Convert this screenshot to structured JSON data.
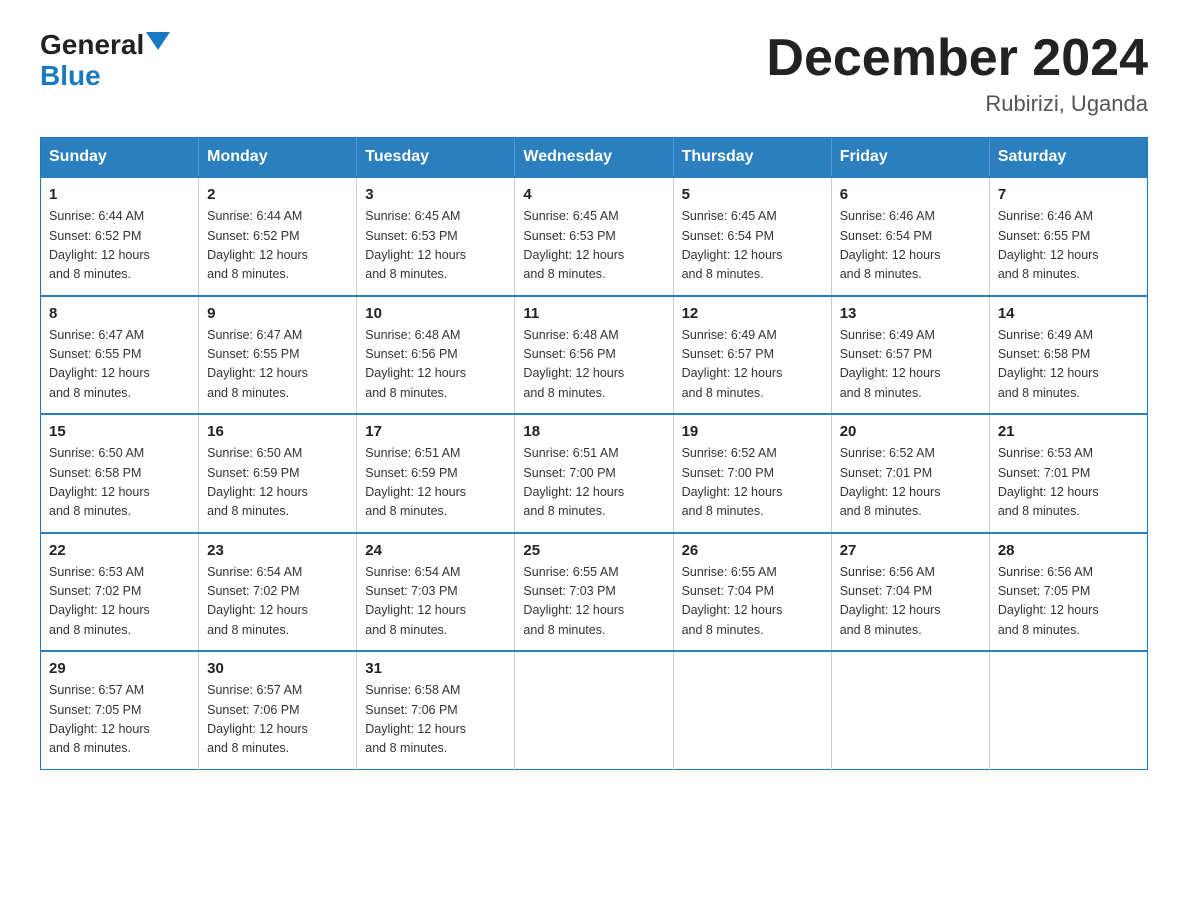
{
  "header": {
    "logo_general": "General",
    "logo_blue": "Blue",
    "month_title": "December 2024",
    "location": "Rubirizi, Uganda"
  },
  "days_of_week": [
    "Sunday",
    "Monday",
    "Tuesday",
    "Wednesday",
    "Thursday",
    "Friday",
    "Saturday"
  ],
  "weeks": [
    [
      {
        "day": "1",
        "sunrise": "6:44 AM",
        "sunset": "6:52 PM",
        "daylight": "12 hours and 8 minutes."
      },
      {
        "day": "2",
        "sunrise": "6:44 AM",
        "sunset": "6:52 PM",
        "daylight": "12 hours and 8 minutes."
      },
      {
        "day": "3",
        "sunrise": "6:45 AM",
        "sunset": "6:53 PM",
        "daylight": "12 hours and 8 minutes."
      },
      {
        "day": "4",
        "sunrise": "6:45 AM",
        "sunset": "6:53 PM",
        "daylight": "12 hours and 8 minutes."
      },
      {
        "day": "5",
        "sunrise": "6:45 AM",
        "sunset": "6:54 PM",
        "daylight": "12 hours and 8 minutes."
      },
      {
        "day": "6",
        "sunrise": "6:46 AM",
        "sunset": "6:54 PM",
        "daylight": "12 hours and 8 minutes."
      },
      {
        "day": "7",
        "sunrise": "6:46 AM",
        "sunset": "6:55 PM",
        "daylight": "12 hours and 8 minutes."
      }
    ],
    [
      {
        "day": "8",
        "sunrise": "6:47 AM",
        "sunset": "6:55 PM",
        "daylight": "12 hours and 8 minutes."
      },
      {
        "day": "9",
        "sunrise": "6:47 AM",
        "sunset": "6:55 PM",
        "daylight": "12 hours and 8 minutes."
      },
      {
        "day": "10",
        "sunrise": "6:48 AM",
        "sunset": "6:56 PM",
        "daylight": "12 hours and 8 minutes."
      },
      {
        "day": "11",
        "sunrise": "6:48 AM",
        "sunset": "6:56 PM",
        "daylight": "12 hours and 8 minutes."
      },
      {
        "day": "12",
        "sunrise": "6:49 AM",
        "sunset": "6:57 PM",
        "daylight": "12 hours and 8 minutes."
      },
      {
        "day": "13",
        "sunrise": "6:49 AM",
        "sunset": "6:57 PM",
        "daylight": "12 hours and 8 minutes."
      },
      {
        "day": "14",
        "sunrise": "6:49 AM",
        "sunset": "6:58 PM",
        "daylight": "12 hours and 8 minutes."
      }
    ],
    [
      {
        "day": "15",
        "sunrise": "6:50 AM",
        "sunset": "6:58 PM",
        "daylight": "12 hours and 8 minutes."
      },
      {
        "day": "16",
        "sunrise": "6:50 AM",
        "sunset": "6:59 PM",
        "daylight": "12 hours and 8 minutes."
      },
      {
        "day": "17",
        "sunrise": "6:51 AM",
        "sunset": "6:59 PM",
        "daylight": "12 hours and 8 minutes."
      },
      {
        "day": "18",
        "sunrise": "6:51 AM",
        "sunset": "7:00 PM",
        "daylight": "12 hours and 8 minutes."
      },
      {
        "day": "19",
        "sunrise": "6:52 AM",
        "sunset": "7:00 PM",
        "daylight": "12 hours and 8 minutes."
      },
      {
        "day": "20",
        "sunrise": "6:52 AM",
        "sunset": "7:01 PM",
        "daylight": "12 hours and 8 minutes."
      },
      {
        "day": "21",
        "sunrise": "6:53 AM",
        "sunset": "7:01 PM",
        "daylight": "12 hours and 8 minutes."
      }
    ],
    [
      {
        "day": "22",
        "sunrise": "6:53 AM",
        "sunset": "7:02 PM",
        "daylight": "12 hours and 8 minutes."
      },
      {
        "day": "23",
        "sunrise": "6:54 AM",
        "sunset": "7:02 PM",
        "daylight": "12 hours and 8 minutes."
      },
      {
        "day": "24",
        "sunrise": "6:54 AM",
        "sunset": "7:03 PM",
        "daylight": "12 hours and 8 minutes."
      },
      {
        "day": "25",
        "sunrise": "6:55 AM",
        "sunset": "7:03 PM",
        "daylight": "12 hours and 8 minutes."
      },
      {
        "day": "26",
        "sunrise": "6:55 AM",
        "sunset": "7:04 PM",
        "daylight": "12 hours and 8 minutes."
      },
      {
        "day": "27",
        "sunrise": "6:56 AM",
        "sunset": "7:04 PM",
        "daylight": "12 hours and 8 minutes."
      },
      {
        "day": "28",
        "sunrise": "6:56 AM",
        "sunset": "7:05 PM",
        "daylight": "12 hours and 8 minutes."
      }
    ],
    [
      {
        "day": "29",
        "sunrise": "6:57 AM",
        "sunset": "7:05 PM",
        "daylight": "12 hours and 8 minutes."
      },
      {
        "day": "30",
        "sunrise": "6:57 AM",
        "sunset": "7:06 PM",
        "daylight": "12 hours and 8 minutes."
      },
      {
        "day": "31",
        "sunrise": "6:58 AM",
        "sunset": "7:06 PM",
        "daylight": "12 hours and 8 minutes."
      },
      null,
      null,
      null,
      null
    ]
  ],
  "sunrise_label": "Sunrise:",
  "sunset_label": "Sunset:",
  "daylight_label": "Daylight:"
}
